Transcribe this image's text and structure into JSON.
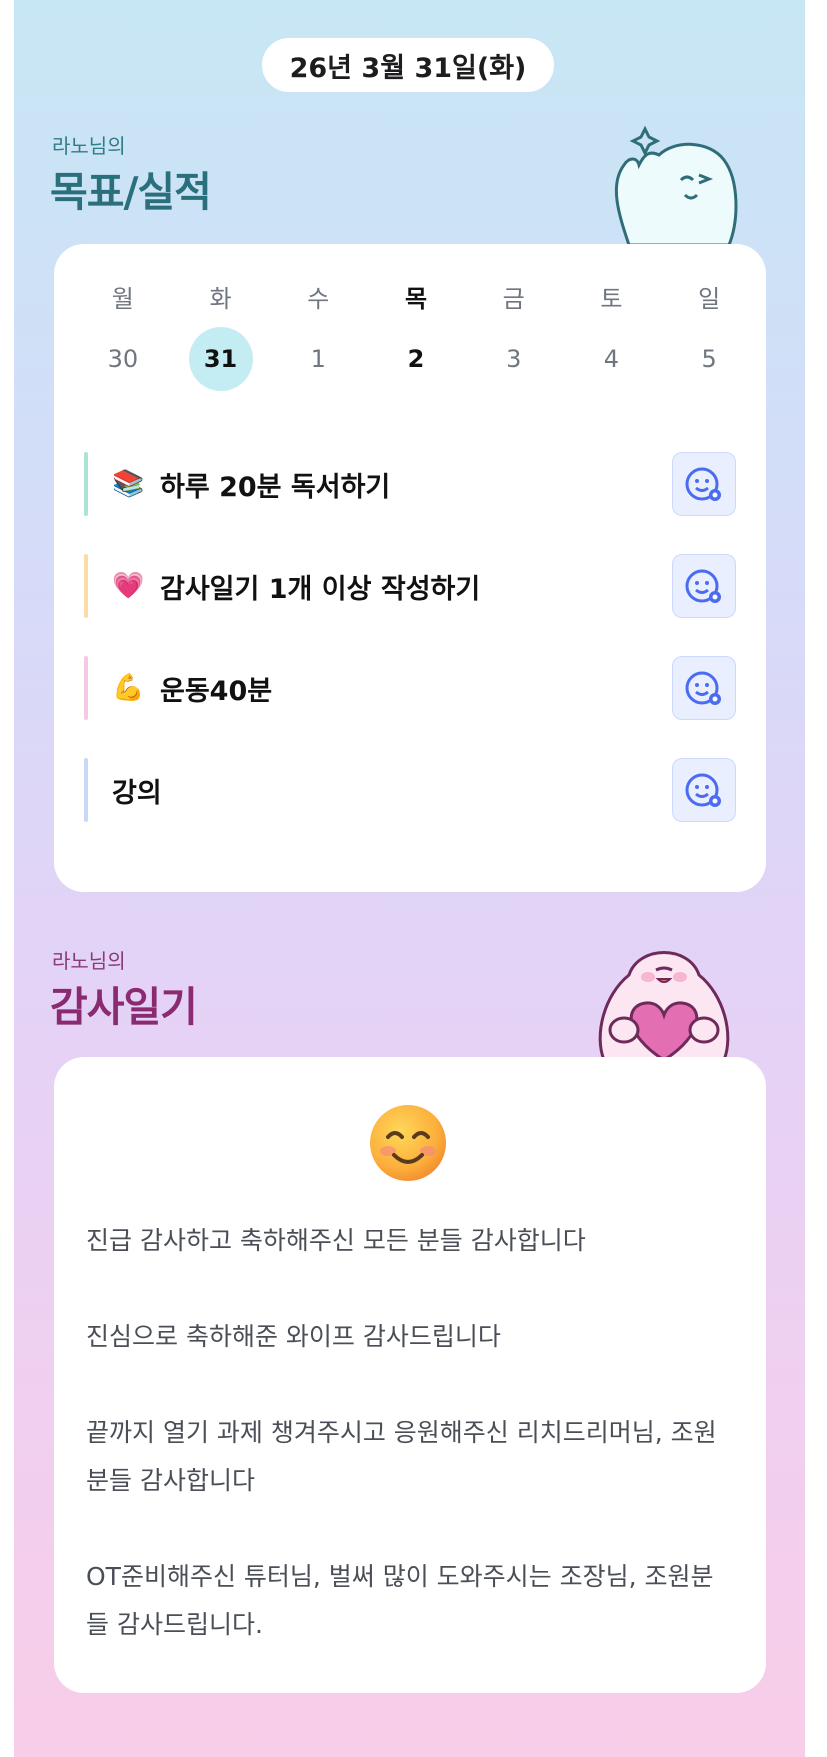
{
  "header": {
    "date": "26년 3월 31일(화)"
  },
  "goals_section": {
    "subtitle": "라노님의",
    "title": "목표/실적",
    "weekdays": [
      "월",
      "화",
      "수",
      "목",
      "금",
      "토",
      "일"
    ],
    "days": [
      "30",
      "31",
      "1",
      "2",
      "3",
      "4",
      "5"
    ],
    "selected_index": 1,
    "bold_index": 3,
    "goals": [
      {
        "emoji": "📚",
        "label": "하루 20분 독서하기",
        "bar_color": "#a9e4d7"
      },
      {
        "emoji": "💗",
        "label": "감사일기 1개 이상 작성하기",
        "bar_color": "#f9dca8"
      },
      {
        "emoji": "💪",
        "label": "운동40분",
        "bar_color": "#f5c9e4"
      },
      {
        "emoji": "",
        "label": "강의",
        "bar_color": "#c9d8f5"
      }
    ],
    "smile_icon_color": "#4a6cf0"
  },
  "diary_section": {
    "subtitle": "라노님의",
    "title": "감사일기",
    "mood_icon": "smiling-face-icon",
    "entries": [
      "진급 감사하고 축하해주신 모든 분들 감사합니다",
      "진심으로 축하해준 와이프 감사드립니다",
      "끝까지 열기 과제 챙겨주시고 응원해주신 리치드리머님, 조원분들 감사합니다",
      "OT준비해주신 튜터님, 벌써 많이 도와주시는 조장님, 조원분들 감사드립니다."
    ]
  }
}
